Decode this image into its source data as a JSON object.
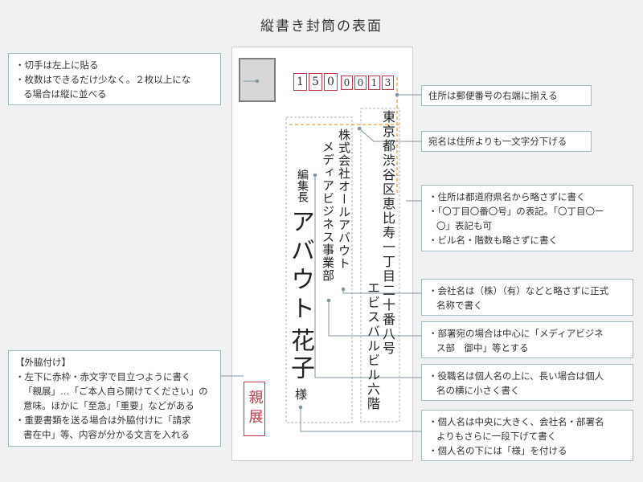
{
  "title": "縦書き封筒の表面",
  "postal_code": {
    "digits": [
      "1",
      "5",
      "0",
      "0",
      "0",
      "1",
      "3"
    ]
  },
  "address": {
    "line1": "東京都渋谷区恵比寿一丁目二十番八号",
    "line2": "エビスバルビル六階"
  },
  "company": {
    "name": "株式会社オールアバウト",
    "department": "メディアビジネス事業部"
  },
  "recipient": {
    "title": "編集長",
    "name_family": "アバウト",
    "name_given": "花子",
    "honorific": "様"
  },
  "seal": {
    "text": "親展",
    "color": "#c23b4f"
  },
  "callouts": {
    "stamp": {
      "lines": [
        "・切手は左上に貼る",
        "・枚数はできるだけ少なく。２枚以上にな",
        "る場合は縦に並べる"
      ]
    },
    "address_align": {
      "text": "住所は郵便番号の右端に揃える"
    },
    "recipient_indent": {
      "text": "宛名は住所よりも一文字分下げる"
    },
    "address_detail": {
      "lines": [
        "・住所は都道府県名から略さずに書く",
        "・「〇丁目〇番〇号」の表記。「〇丁目〇ー",
        "〇」表記も可",
        "・ビル名・階数も略さずに書く"
      ]
    },
    "company": {
      "lines": [
        "・会社名は（株）（有）などと略さずに正式",
        "名称で書く"
      ]
    },
    "department": {
      "lines": [
        "・部署宛の場合は中心に「メディアビジネ",
        "ス部　御中」等とする"
      ]
    },
    "title": {
      "lines": [
        "・役職名は個人名の上に、長い場合は個人",
        "名の横に小さく書く"
      ]
    },
    "personal_name": {
      "lines": [
        "・個人名は中央に大きく、会社名・部署名",
        "よりもさらに一段下げて書く",
        "・個人名の下には「様」を付ける"
      ]
    },
    "sidenote": {
      "heading": "【外脇付け】",
      "lines": [
        "・左下に赤枠・赤文字で目立つように書く",
        "「親展」…「ご本人自ら開けてください」の",
        "意味。ほかに「至急」「重要」などがある",
        "・重要書類を送る場合は外脇付けに「請求",
        "書在中」等、内容が分かる文言を入れる"
      ]
    }
  },
  "colors": {
    "accent_red": "#c23b4f",
    "guide_orange": "#e8a23a",
    "callout_border": "#9fbbc4",
    "leader_line": "#7f97a0"
  }
}
